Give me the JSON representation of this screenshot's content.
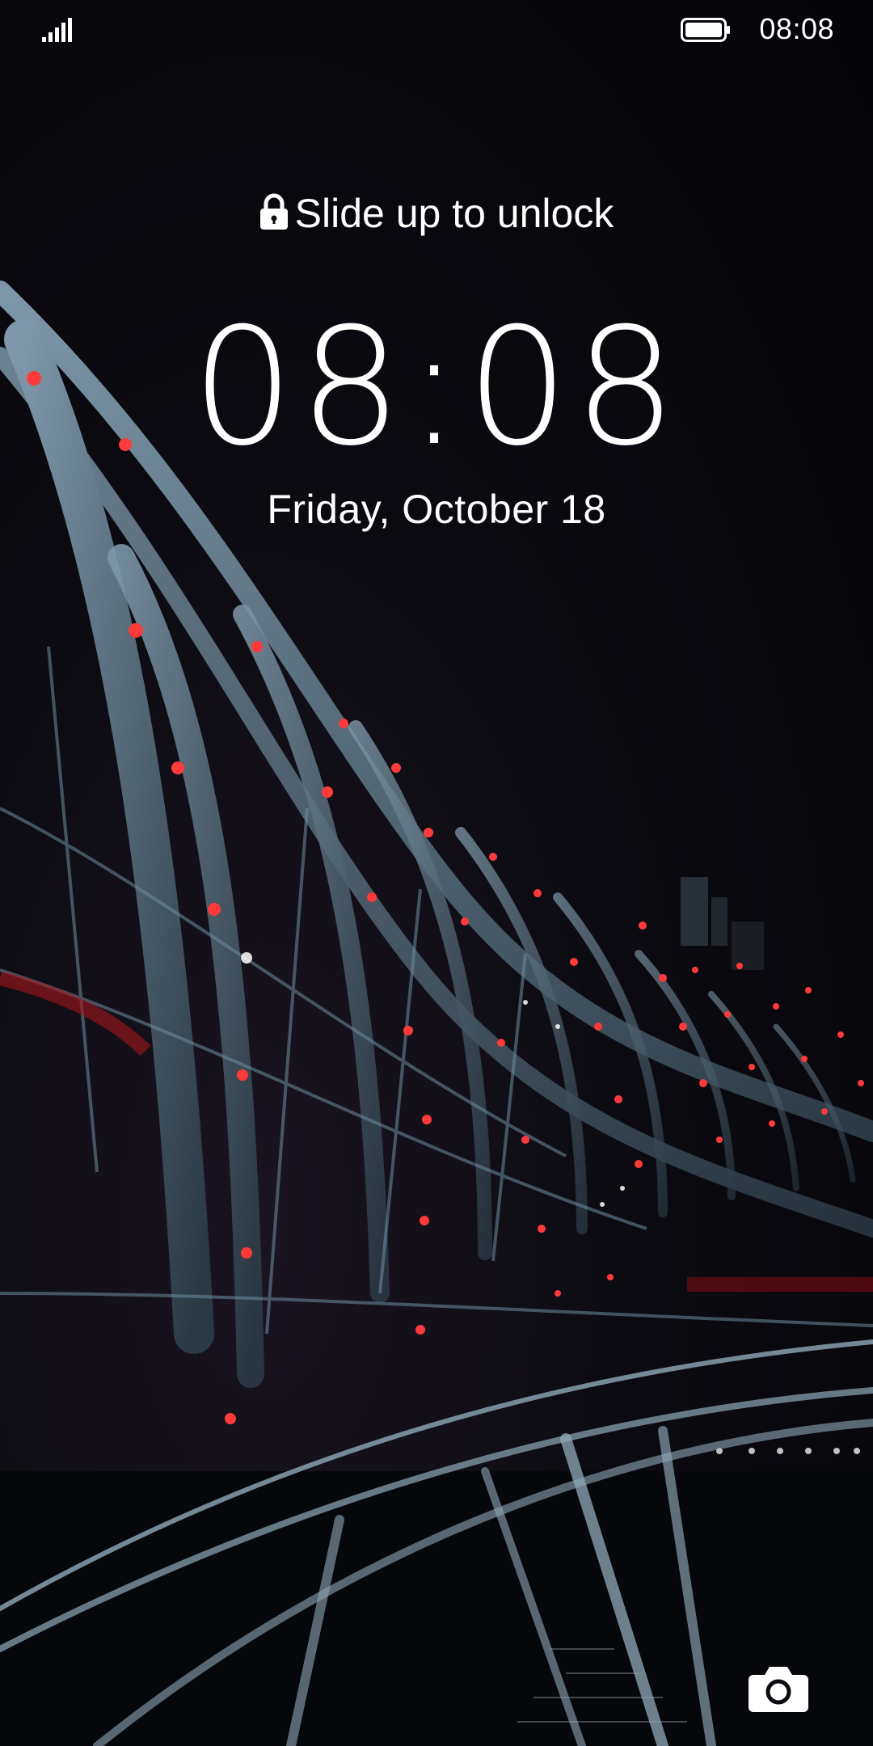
{
  "status_bar": {
    "time": "08:08",
    "icons": [
      "signal-icon",
      "battery-icon"
    ]
  },
  "lock_screen": {
    "unlock_hint": "Slide up to unlock",
    "clock": "08:08",
    "date": "Friday, October 18",
    "icons": [
      "lock-icon",
      "camera-icon"
    ]
  },
  "colors": {
    "background": "#07060b",
    "text": "#ffffff",
    "bridge_steel": "#5c7585",
    "bridge_lights": "#ff3a3a"
  }
}
